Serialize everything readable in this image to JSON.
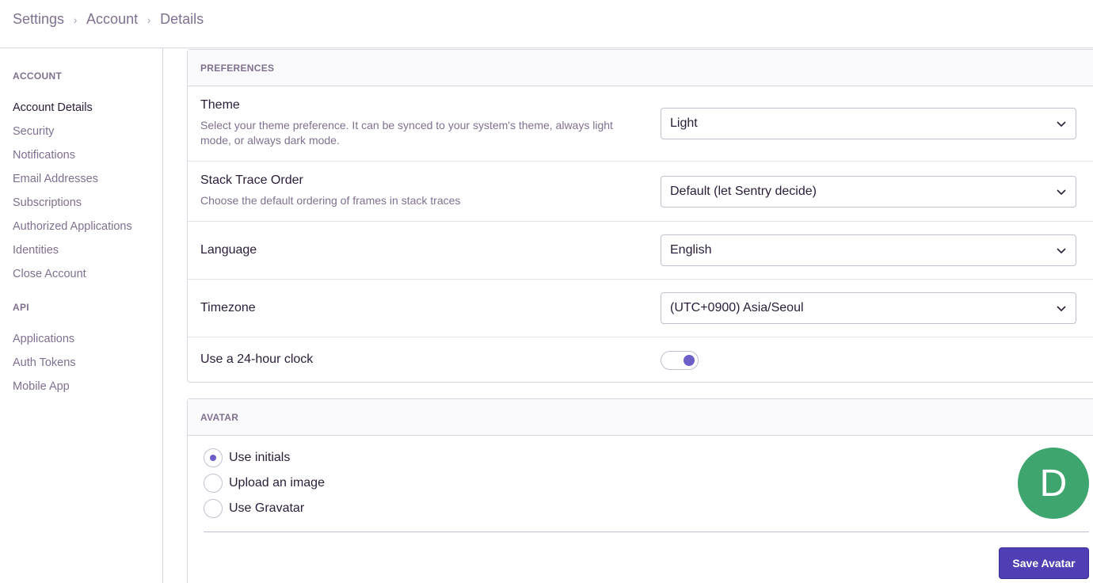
{
  "breadcrumb": {
    "items": [
      "Settings",
      "Account",
      "Details"
    ]
  },
  "sidebar": {
    "account_heading": "ACCOUNT",
    "account_items": [
      "Account Details",
      "Security",
      "Notifications",
      "Email Addresses",
      "Subscriptions",
      "Authorized Applications",
      "Identities",
      "Close Account"
    ],
    "active_item": "Account Details",
    "api_heading": "API",
    "api_items": [
      "Applications",
      "Auth Tokens",
      "Mobile App"
    ]
  },
  "preferences": {
    "title": "PREFERENCES",
    "theme": {
      "label": "Theme",
      "help": "Select your theme preference. It can be synced to your system's theme, always light mode, or always dark mode.",
      "value": "Light"
    },
    "stack_trace": {
      "label": "Stack Trace Order",
      "help": "Choose the default ordering of frames in stack traces",
      "value": "Default (let Sentry decide)"
    },
    "language": {
      "label": "Language",
      "value": "English"
    },
    "timezone": {
      "label": "Timezone",
      "value": "(UTC+0900) Asia/Seoul"
    },
    "clock": {
      "label": "Use a 24-hour clock",
      "enabled": true
    }
  },
  "avatar": {
    "title": "AVATAR",
    "options": [
      "Use initials",
      "Upload an image",
      "Use Gravatar"
    ],
    "selected": "Use initials",
    "initial": "D",
    "save_label": "Save Avatar",
    "avatar_color": "#3fa56f"
  },
  "colors": {
    "accent": "#6c5fc7",
    "button": "#4e3fb4"
  }
}
